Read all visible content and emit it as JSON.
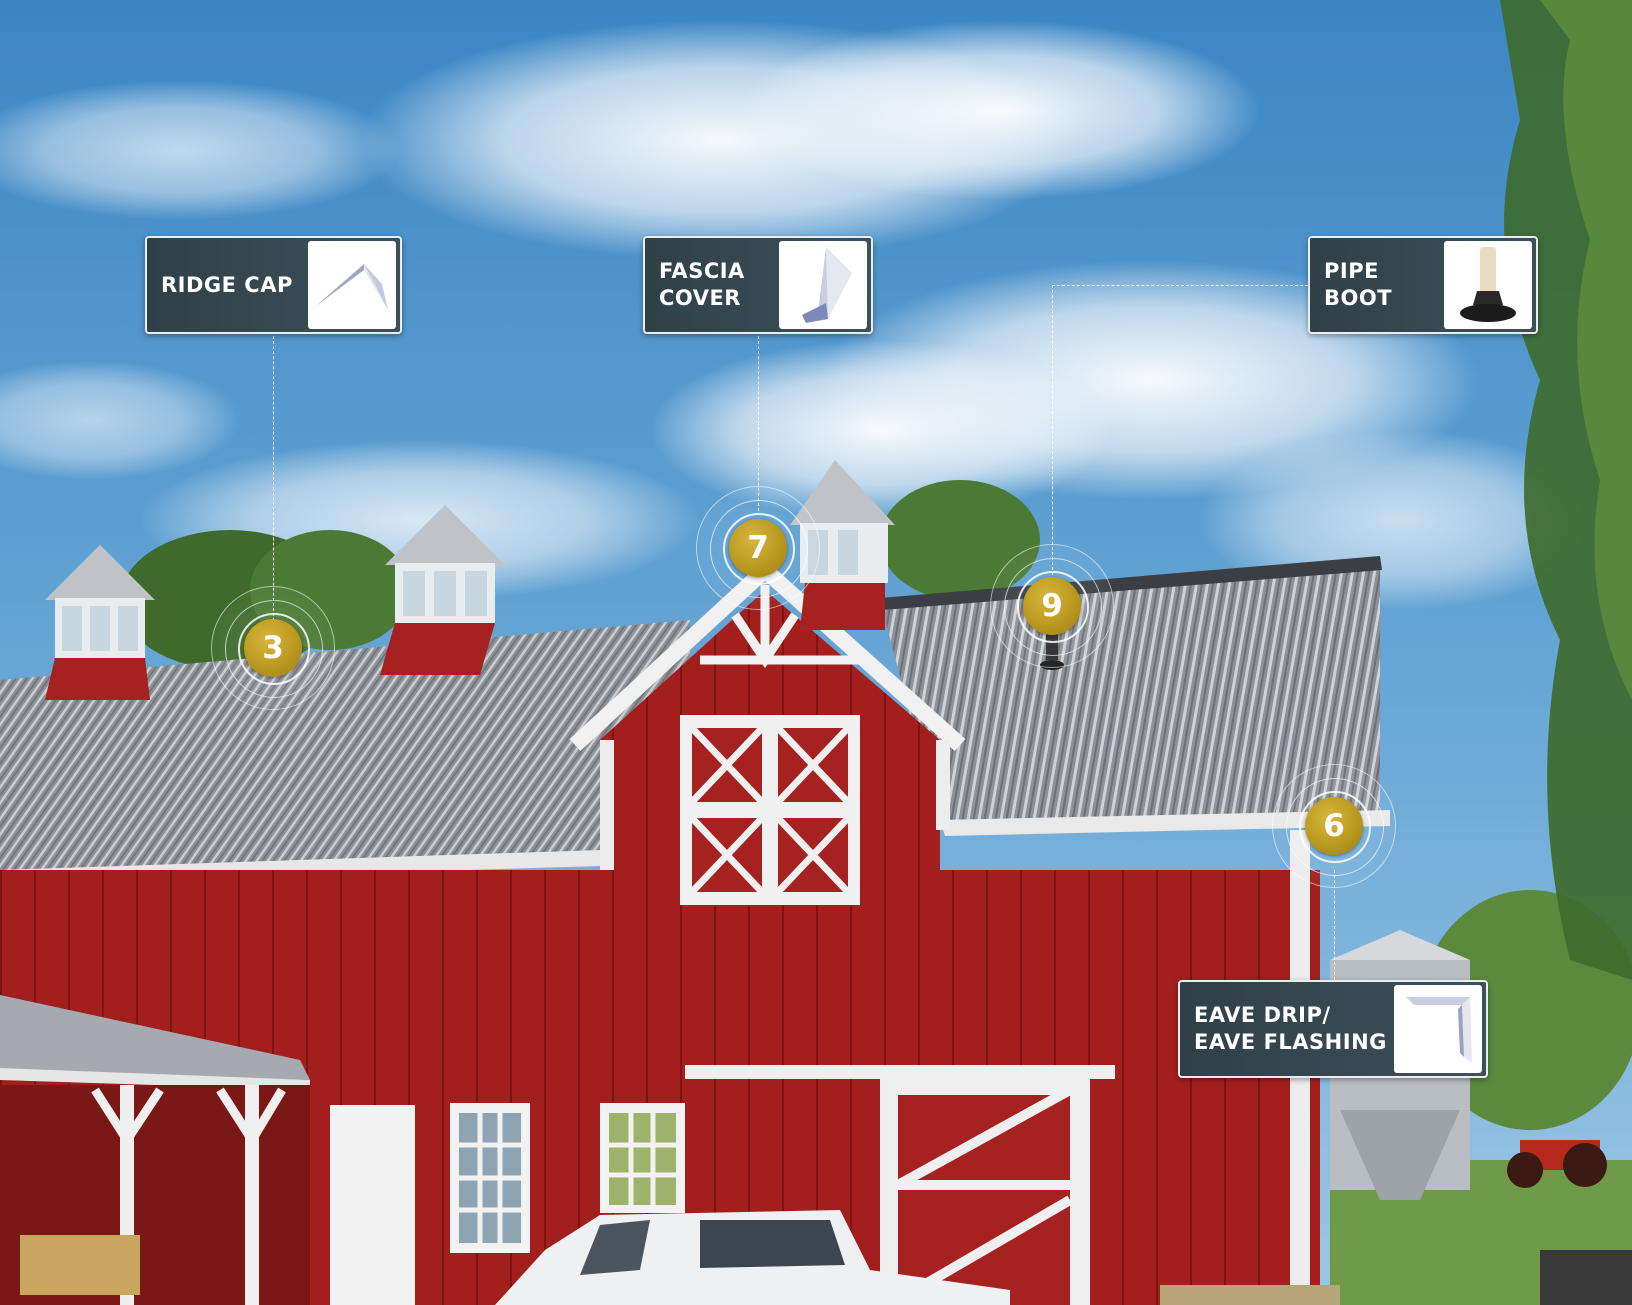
{
  "scene": {
    "sky_color": "#3f8ac6",
    "barn_color": "#a0201f",
    "roof_color": "#8a8f96",
    "accent_gold": "#c4a229"
  },
  "callouts": {
    "ridge_cap": {
      "label": "RIDGE CAP",
      "icon": "ridge-cap-product-icon"
    },
    "fascia_cover": {
      "label": "FASCIA\nCOVER",
      "icon": "fascia-cover-product-icon"
    },
    "pipe_boot": {
      "label": "PIPE\nBOOT",
      "icon": "pipe-boot-product-icon"
    },
    "eave_drip": {
      "label": "EAVE DRIP/\nEAVE FLASHING",
      "icon": "eave-drip-product-icon"
    }
  },
  "markers": {
    "ridge_cap": {
      "number": "3"
    },
    "fascia_cover": {
      "number": "7"
    },
    "pipe_boot": {
      "number": "9"
    },
    "eave_drip": {
      "number": "6"
    }
  }
}
